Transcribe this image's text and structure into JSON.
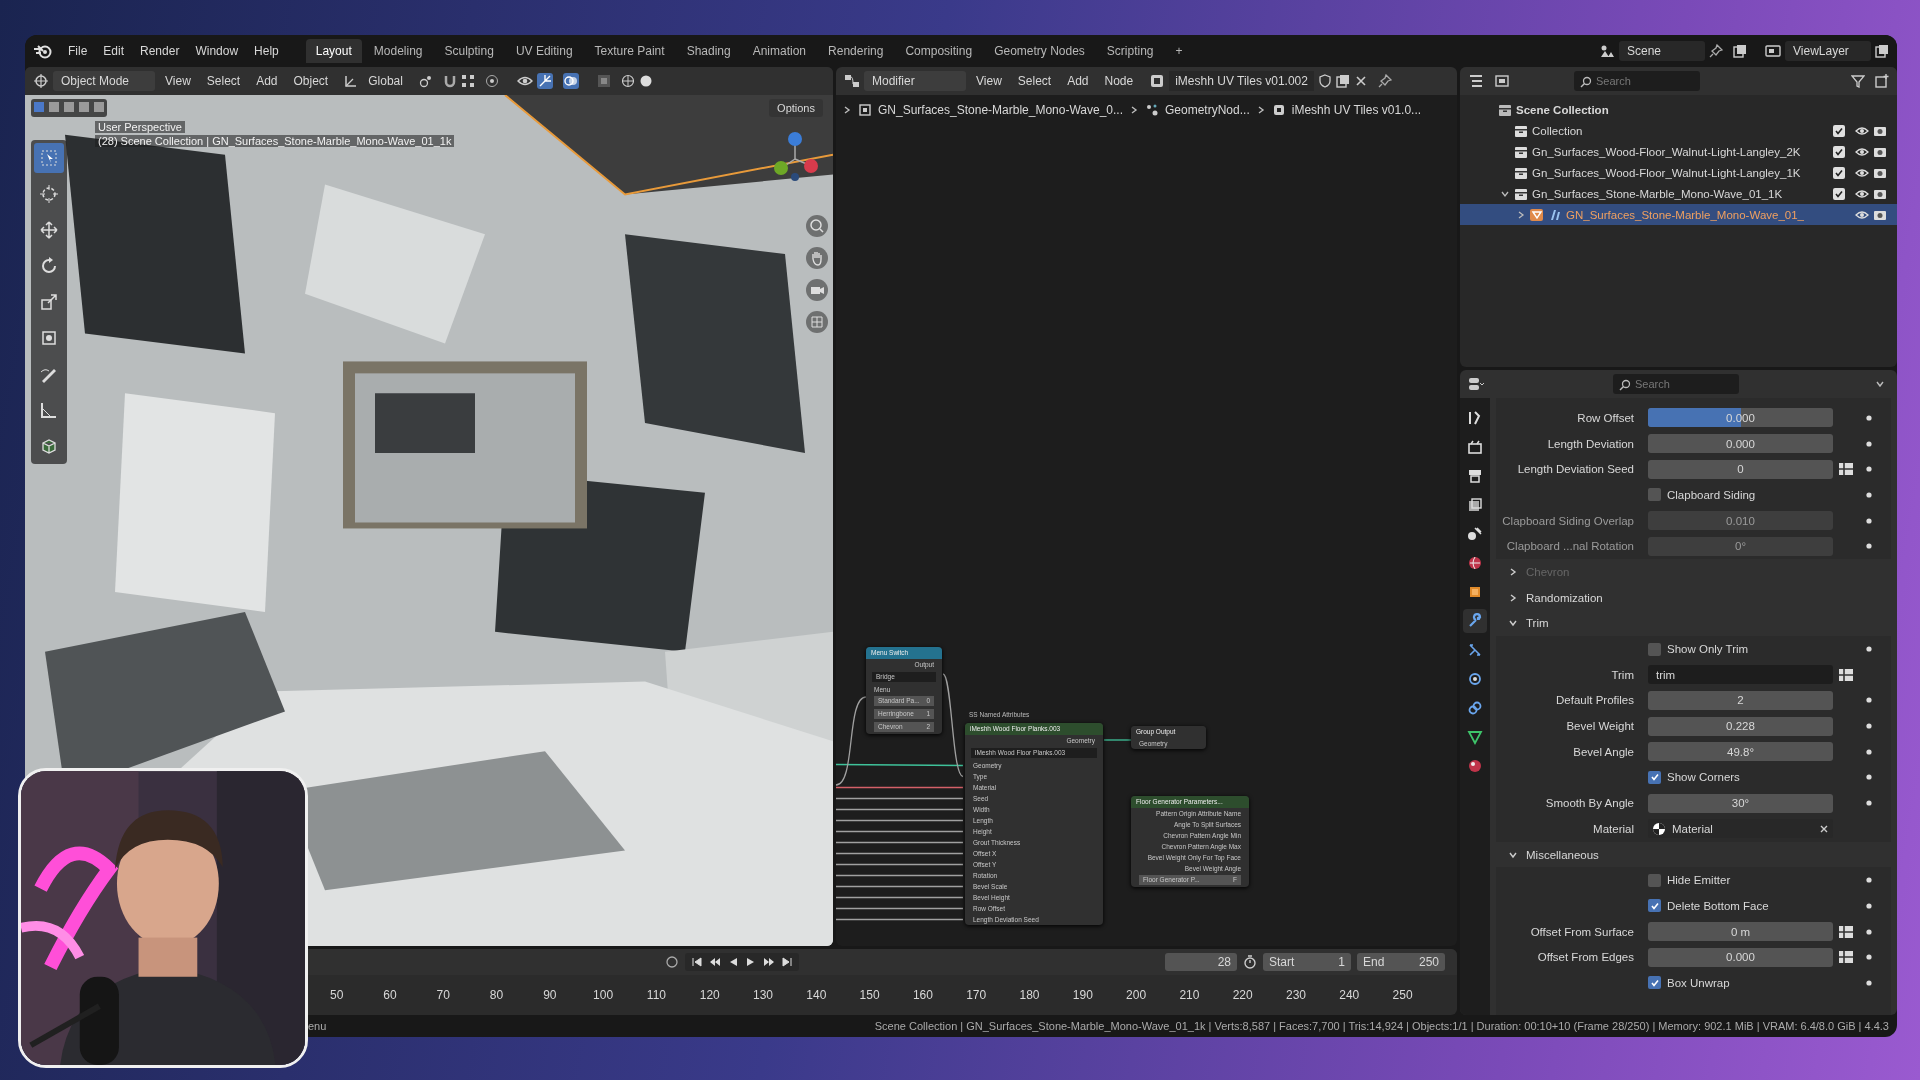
{
  "menu": [
    "File",
    "Edit",
    "Render",
    "Window",
    "Help"
  ],
  "workspaces": [
    {
      "label": "Layout",
      "selected": true
    },
    {
      "label": "Modeling",
      "selected": false
    },
    {
      "label": "Sculpting",
      "selected": false
    },
    {
      "label": "UV Editing",
      "selected": false
    },
    {
      "label": "Texture Paint",
      "selected": false
    },
    {
      "label": "Shading",
      "selected": false
    },
    {
      "label": "Animation",
      "selected": false
    },
    {
      "label": "Rendering",
      "selected": false
    },
    {
      "label": "Compositing",
      "selected": false
    },
    {
      "label": "Geometry Nodes",
      "selected": false
    },
    {
      "label": "Scripting",
      "selected": false
    }
  ],
  "add_workspace": "+",
  "scene": "Scene",
  "view_layer": "ViewLayer",
  "viewport": {
    "mode": "Object Mode",
    "menus": [
      "View",
      "Select",
      "Add",
      "Object"
    ],
    "orientation": "Global",
    "options": "Options",
    "view_name": "User Perspective",
    "view_info": "(28) Scene Collection | GN_Surfaces_Stone-Marble_Mono-Wave_01_1k",
    "tools": [
      {
        "selected": true
      },
      {
        "selected": false
      },
      {
        "selected": false
      },
      {
        "selected": false
      },
      {
        "selected": false
      },
      {
        "selected": false
      },
      {
        "selected": false
      },
      {
        "selected": false
      },
      {
        "selected": false
      }
    ]
  },
  "node_editor": {
    "editor": "Modifier",
    "menus": [
      "View",
      "Select",
      "Add",
      "Node"
    ],
    "node_group": "iMeshh UV Tiles v01.002",
    "breadcrumbs": [
      "GN_Surfaces_Stone-Marble_Mono-Wave_0...",
      "GeometryNod...",
      "iMeshh UV Tiles v01.0..."
    ],
    "menu_switch": {
      "title": "Menu Switch",
      "output": "Output",
      "menu": "Bridge",
      "menu_input": "Menu",
      "items": [
        {
          "label": "Standard Pa...",
          "value": "0"
        },
        {
          "label": "Herringbone",
          "value": "1"
        },
        {
          "label": "Chevron",
          "value": "2"
        }
      ]
    },
    "group_node": {
      "caption": "SS Named Attributes",
      "title": "iMeshh Wood Floor Planks.003",
      "output": "Geometry",
      "group": "iMeshh Wood Floor Planks.003",
      "inputs": [
        "Geometry",
        "Type",
        "Material",
        "Seed",
        "Width",
        "Length",
        "Height",
        "Grout Thickness",
        "Offset X",
        "Offset Y",
        "Rotation",
        "Bevel Scale",
        "Bevel Height",
        "Row Offset",
        "Length Deviation Seed"
      ]
    },
    "group_output": {
      "title": "Group Output",
      "input": "Geometry"
    },
    "parameters_node": {
      "title": "Floor Generator Parameters...",
      "outputs": [
        "Pattern Origin Attribute Name",
        "Angle To Split Surfaces",
        "Chevron Pattern Angle Min",
        "Chevron Pattern Angle Max",
        "Bevel Weight Only For Top Face",
        "Bevel Weight Angle"
      ],
      "group": "Floor Generator P...",
      "users": "F"
    }
  },
  "outliner": {
    "search_placeholder": "Search",
    "tree": [
      {
        "kind": "scene",
        "label": "Scene Collection",
        "selected": false,
        "children": [
          {
            "kind": "collection",
            "label": "Collection",
            "selected": false,
            "checked": true
          },
          {
            "kind": "collection",
            "label": "Gn_Surfaces_Wood-Floor_Walnut-Light-Langley_2K",
            "selected": false,
            "checked": true
          },
          {
            "kind": "collection",
            "label": "Gn_Surfaces_Wood-Floor_Walnut-Light-Langley_1K",
            "selected": false,
            "checked": true
          },
          {
            "kind": "collection",
            "label": "Gn_Surfaces_Stone-Marble_Mono-Wave_01_1K",
            "selected": false,
            "checked": true,
            "expanded": true,
            "children": [
              {
                "kind": "object",
                "label": "GN_Surfaces_Stone-Marble_Mono-Wave_01_",
                "selected": true,
                "expanded": false
              }
            ]
          }
        ]
      }
    ]
  },
  "properties": {
    "search_placeholder": "Search",
    "tabs": [
      {
        "selected": false
      },
      {
        "selected": false
      },
      {
        "selected": false
      },
      {
        "selected": false
      },
      {
        "selected": false
      },
      {
        "selected": false
      },
      {
        "selected": false
      },
      {
        "selected": true
      },
      {
        "selected": false
      },
      {
        "selected": false
      },
      {
        "selected": false
      },
      {
        "selected": false
      },
      {
        "selected": false
      }
    ],
    "rows": [
      {
        "kind": "number",
        "label": "Row Offset",
        "value": "0.000",
        "level": 0.5,
        "disabled": false
      },
      {
        "kind": "number",
        "label": "Length Deviation",
        "value": "0.000",
        "disabled": false
      },
      {
        "kind": "number",
        "label": "Length Deviation Seed",
        "value": "0",
        "attribute": true,
        "disabled": false
      },
      {
        "kind": "checkbox",
        "label": "Clapboard Siding",
        "checked": false,
        "disabled": false
      },
      {
        "kind": "number",
        "label": "Clapboard Siding Overlap",
        "value": "0.010",
        "disabled": true
      },
      {
        "kind": "number",
        "label": "Clapboard ...nal Rotation",
        "value": "0°",
        "disabled": true
      },
      {
        "kind": "panel",
        "label": "Chevron",
        "expanded": false,
        "disabled": true
      },
      {
        "kind": "panel",
        "label": "Randomization",
        "expanded": false,
        "disabled": false
      },
      {
        "kind": "panel",
        "label": "Trim",
        "expanded": true,
        "disabled": false
      },
      {
        "kind": "checkbox",
        "label": "Show Only Trim",
        "checked": false,
        "disabled": false
      },
      {
        "kind": "text",
        "label": "Trim",
        "value": "trim",
        "attribute": true,
        "disabled": false
      },
      {
        "kind": "number",
        "label": "Default Profiles",
        "value": "2",
        "disabled": false
      },
      {
        "kind": "number",
        "label": "Bevel Weight",
        "value": "0.228",
        "disabled": false
      },
      {
        "kind": "number",
        "label": "Bevel Angle",
        "value": "49.8°",
        "disabled": false
      },
      {
        "kind": "checkbox",
        "label": "Show Corners",
        "checked": true,
        "disabled": false
      },
      {
        "kind": "number",
        "label": "Smooth By Angle",
        "value": "30°",
        "disabled": false
      },
      {
        "kind": "material",
        "label": "Material",
        "value": "Material",
        "disabled": false
      },
      {
        "kind": "panel",
        "label": "Miscellaneous",
        "expanded": true,
        "disabled": false
      },
      {
        "kind": "checkbox",
        "label": "Hide Emitter",
        "checked": false,
        "disabled": false
      },
      {
        "kind": "checkbox",
        "label": "Delete Bottom Face",
        "checked": true,
        "disabled": false
      },
      {
        "kind": "number",
        "label": "Offset From Surface",
        "value": "0 m",
        "attribute": true,
        "disabled": false
      },
      {
        "kind": "number",
        "label": "Offset From Edges",
        "value": "0.000",
        "attribute": true,
        "disabled": false
      },
      {
        "kind": "checkbox",
        "label": "Box Unwrap",
        "checked": true,
        "disabled": false
      }
    ]
  },
  "timeline": {
    "current_frame": "28",
    "start_label": "Start",
    "start": "1",
    "end_label": "End",
    "end": "250",
    "frames": [
      "50",
      "60",
      "70",
      "80",
      "90",
      "100",
      "110",
      "120",
      "130",
      "140",
      "150",
      "160",
      "170",
      "180",
      "190",
      "200",
      "210",
      "220",
      "230",
      "240",
      "250"
    ]
  },
  "status_bar": {
    "left": "enu",
    "info": "Scene Collection | GN_Surfaces_Stone-Marble_Mono-Wave_01_1k | Verts:8,587 | Faces:7,700 | Tris:14,924 | Objects:1/1 | Duration: 00:10+10 (Frame 28/250) | Memory: 902.1 MiB | VRAM: 6.4/8.0 GiB | 4.4.3"
  }
}
